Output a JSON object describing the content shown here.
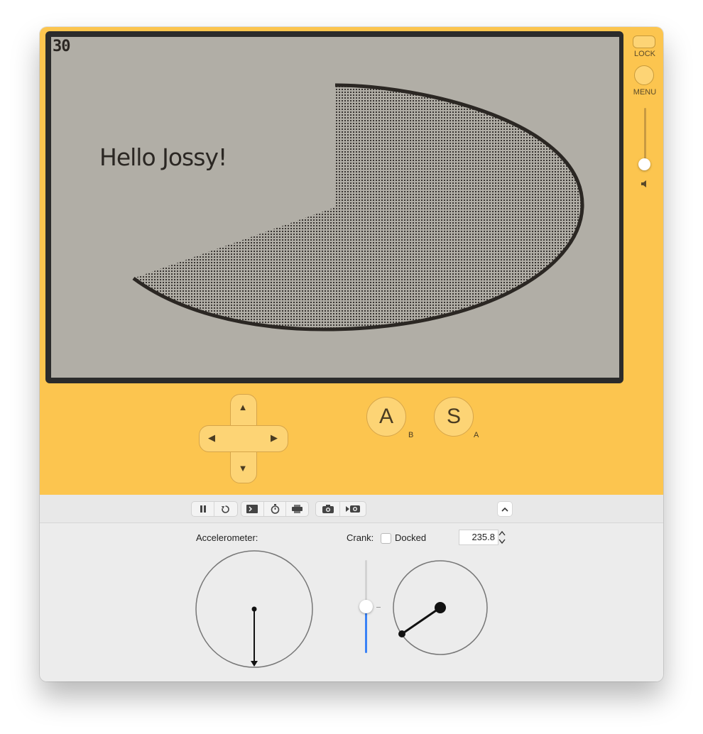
{
  "screen": {
    "fps": "30",
    "greeting": "Hello Jossy!"
  },
  "side_controls": {
    "lock_label": "LOCK",
    "menu_label": "MENU",
    "volume_level": 0.2
  },
  "buttons": {
    "a_label": "A",
    "a_sub": "B",
    "s_label": "S",
    "s_sub": "A"
  },
  "dpad": {
    "up": "▲",
    "down": "▼",
    "left": "◀",
    "right": "▶"
  },
  "toolbar": {
    "icons": [
      "pause-icon",
      "restart-icon",
      "console-icon",
      "stopwatch-icon",
      "printer-icon",
      "camera-icon",
      "record-icon",
      "chevron-up-icon"
    ]
  },
  "controls": {
    "accelerometer_label": "Accelerometer:",
    "crank_label": "Crank:",
    "docked_label": "Docked",
    "docked_checked": false,
    "crank_angle": "235.8"
  },
  "colors": {
    "device": "#fcc54f",
    "screen": "#b1aea6",
    "ink": "#2b2723",
    "slider_active": "#3b82f6"
  }
}
